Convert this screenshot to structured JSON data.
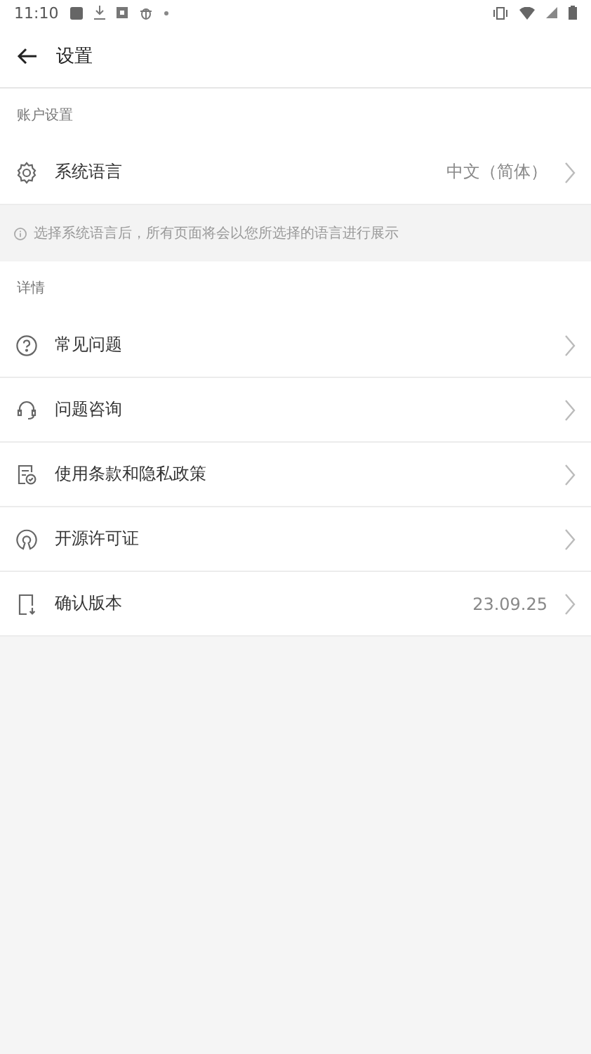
{
  "status_bar": {
    "time": "11:10"
  },
  "toolbar": {
    "title": "设置"
  },
  "account_section": {
    "header": "账户设置",
    "rows": [
      {
        "kind": "language",
        "label": "系统语言",
        "value": "中文（简体）"
      }
    ]
  },
  "notice": "选择系统语言后，所有页面将会以您所选择的语言进行展示",
  "details_section": {
    "header": "详情",
    "rows": [
      {
        "kind": "faq",
        "label": "常见问题"
      },
      {
        "kind": "support",
        "label": "问题咨询"
      },
      {
        "kind": "terms",
        "label": "使用条款和隐私政策"
      },
      {
        "kind": "license",
        "label": "开源许可证"
      },
      {
        "kind": "version",
        "label": "确认版本",
        "value": "23.09.25"
      }
    ]
  }
}
